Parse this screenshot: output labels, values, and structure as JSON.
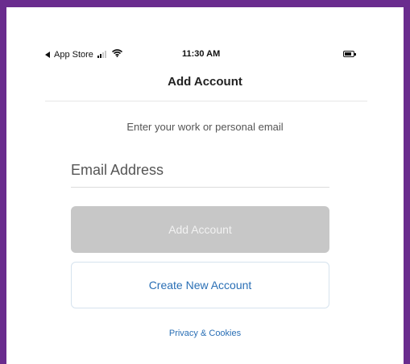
{
  "status_bar": {
    "back_app": "App Store",
    "time": "11:30 AM"
  },
  "header": {
    "title": "Add Account"
  },
  "form": {
    "instructions": "Enter your work or personal email",
    "email_placeholder": "Email Address",
    "add_account_label": "Add Account",
    "create_account_label": "Create New Account",
    "privacy_label": "Privacy & Cookies"
  },
  "colors": {
    "frame": "#6a2c8e",
    "link": "#2a6fb5",
    "disabled_button": "#c7c7c7"
  },
  "icons": [
    "back-arrow-icon",
    "cellular-signal-icon",
    "wifi-icon",
    "battery-icon"
  ]
}
